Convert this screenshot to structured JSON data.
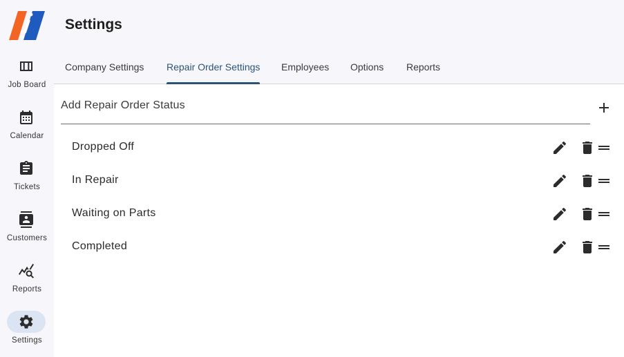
{
  "app": {
    "title": "Settings",
    "brand_colors": {
      "orange": "#f26522",
      "blue": "#1f5bbf"
    }
  },
  "nav": {
    "items": [
      {
        "label": "Job Board",
        "icon": "view-week-icon",
        "active": false
      },
      {
        "label": "Calendar",
        "icon": "calendar-icon",
        "active": false
      },
      {
        "label": "Tickets",
        "icon": "clipboard-icon",
        "active": false
      },
      {
        "label": "Customers",
        "icon": "contact-card-icon",
        "active": false
      },
      {
        "label": "Reports",
        "icon": "query-stats-icon",
        "active": false
      },
      {
        "label": "Settings",
        "icon": "gear-icon",
        "active": true
      }
    ],
    "active_color": "#dbe4f2"
  },
  "tabs": [
    {
      "label": "Company Settings",
      "active": false
    },
    {
      "label": "Repair Order Settings",
      "active": true
    },
    {
      "label": "Employees",
      "active": false
    },
    {
      "label": "Options",
      "active": false
    },
    {
      "label": "Reports",
      "active": false
    }
  ],
  "add_status": {
    "placeholder": "Add Repair Order Status",
    "value": "",
    "add_icon": "plus-icon"
  },
  "statuses": [
    {
      "label": "Dropped Off"
    },
    {
      "label": "In Repair"
    },
    {
      "label": "Waiting on Parts"
    },
    {
      "label": "Completed"
    }
  ],
  "row_icons": {
    "edit": "pencil-icon",
    "delete": "trash-icon",
    "reorder": "drag-handle-icon"
  },
  "accent_color": "#2a5377"
}
